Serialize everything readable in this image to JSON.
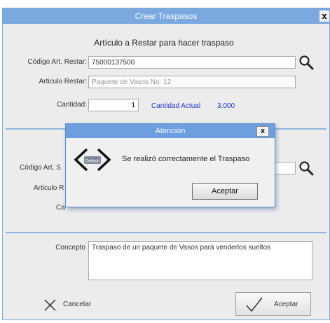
{
  "window": {
    "title": "Crear Traspasos",
    "close_label": "x"
  },
  "restar": {
    "heading": "Artículo a Restar para hacer traspaso",
    "codigo_label": "Código Art. Restar:",
    "codigo_value": "75000137500",
    "articulo_label": "Articulo Restar:",
    "articulo_value": "Paquete de Vasos No. 12",
    "cantidad_label": "Cantidad:",
    "cantidad_value": "1",
    "cantidad_actual_label": "Cantidad Actual",
    "cantidad_actual_value": "3.000"
  },
  "sumar": {
    "codigo_label": "Código Art. S",
    "articulo_label": "Articulo R",
    "cantidad_label": "Ca"
  },
  "concepto": {
    "label": "Concepto",
    "value": "Traspaso de un paquete de Vasos para venderlos sueltos"
  },
  "footer": {
    "cancel_label": "Cancelar",
    "accept_label": "Aceptar"
  },
  "dialog": {
    "title": "Atención",
    "close_label": "x",
    "icon_text": "Default",
    "message": "Se realizó correctamente el Traspaso",
    "ok_label": "Aceptar"
  },
  "colors": {
    "titlebar": "#7ba9df",
    "dialog_titlebar": "#6d9fe0",
    "accent_blue": "#2432c8"
  },
  "icons": [
    "search-icon",
    "search-icon",
    "cancel-x-icon",
    "checkmark-icon",
    "code-brackets-icon"
  ]
}
